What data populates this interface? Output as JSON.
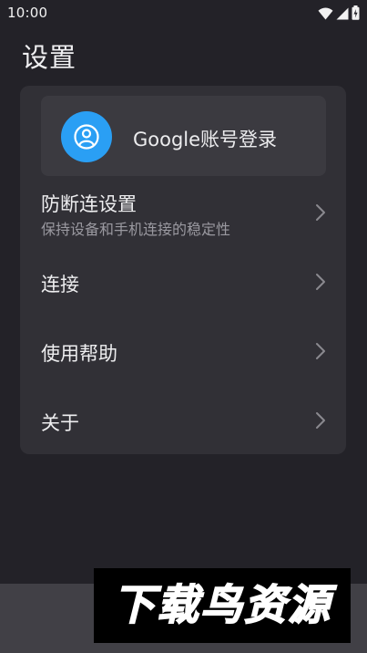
{
  "status_bar": {
    "time": "10:00",
    "icons": [
      "wifi-icon",
      "signal-icon",
      "battery-icon"
    ]
  },
  "page": {
    "title": "设置"
  },
  "google_account": {
    "label": "Google账号登录",
    "avatar_icon": "user-icon",
    "avatar_color": "#2a9ff4"
  },
  "menu": {
    "items": [
      {
        "label": "防断连设置",
        "subtitle": "保持设备和手机连接的稳定性",
        "icon": "chevron-right-icon"
      },
      {
        "label": "连接",
        "icon": "chevron-right-icon"
      },
      {
        "label": "使用帮助",
        "icon": "chevron-right-icon"
      },
      {
        "label": "关于",
        "icon": "chevron-right-icon"
      }
    ]
  },
  "watermark": {
    "text": "下载鸟资源"
  },
  "colors": {
    "background": "#232228",
    "card": "#313036",
    "google_card": "#3b3a40",
    "accent": "#2a9ff4",
    "bottom_bar": "#414046"
  }
}
